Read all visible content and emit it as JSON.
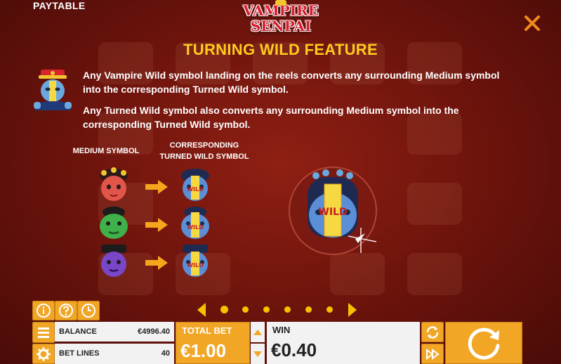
{
  "header": {
    "section_label": "PAYTABLE",
    "logo_line1": "VAMPIRE",
    "logo_line2": "SENPAI"
  },
  "feature": {
    "title": "TURNING WILD FEATURE",
    "description_1": "Any Vampire Wild symbol landing on the reels converts any surrounding Medium symbol into the corresponding Turned Wild symbol.",
    "description_2": "Any Turned Wild symbol also converts any surrounding Medium symbol into the corresponding Turned Wild symbol.",
    "column_medium": "MEDIUM SYMBOL",
    "column_wild": "CORRESPONDING TURNED WILD SYMBOL",
    "wild_tag": "WILD",
    "rows": [
      {
        "medium": "red-girl-symbol",
        "color": "#e2554a"
      },
      {
        "medium": "green-ogre-symbol",
        "color": "#3fb04a"
      },
      {
        "medium": "purple-man-symbol",
        "color": "#7a46c8"
      }
    ]
  },
  "pager": {
    "pages": 6,
    "current_page": 1
  },
  "bottom_bar": {
    "balance_label": "BALANCE",
    "balance_value": "€4996.40",
    "bet_lines_label": "BET LINES",
    "bet_lines_value": "40",
    "total_bet_label": "TOTAL BET",
    "total_bet_value": "€1.00",
    "win_label": "WIN",
    "win_value": "€0.40"
  },
  "colors": {
    "accent": "#f1a625",
    "title": "#ffcc1e",
    "background": "#6a130c",
    "dot": "#f5c200"
  }
}
